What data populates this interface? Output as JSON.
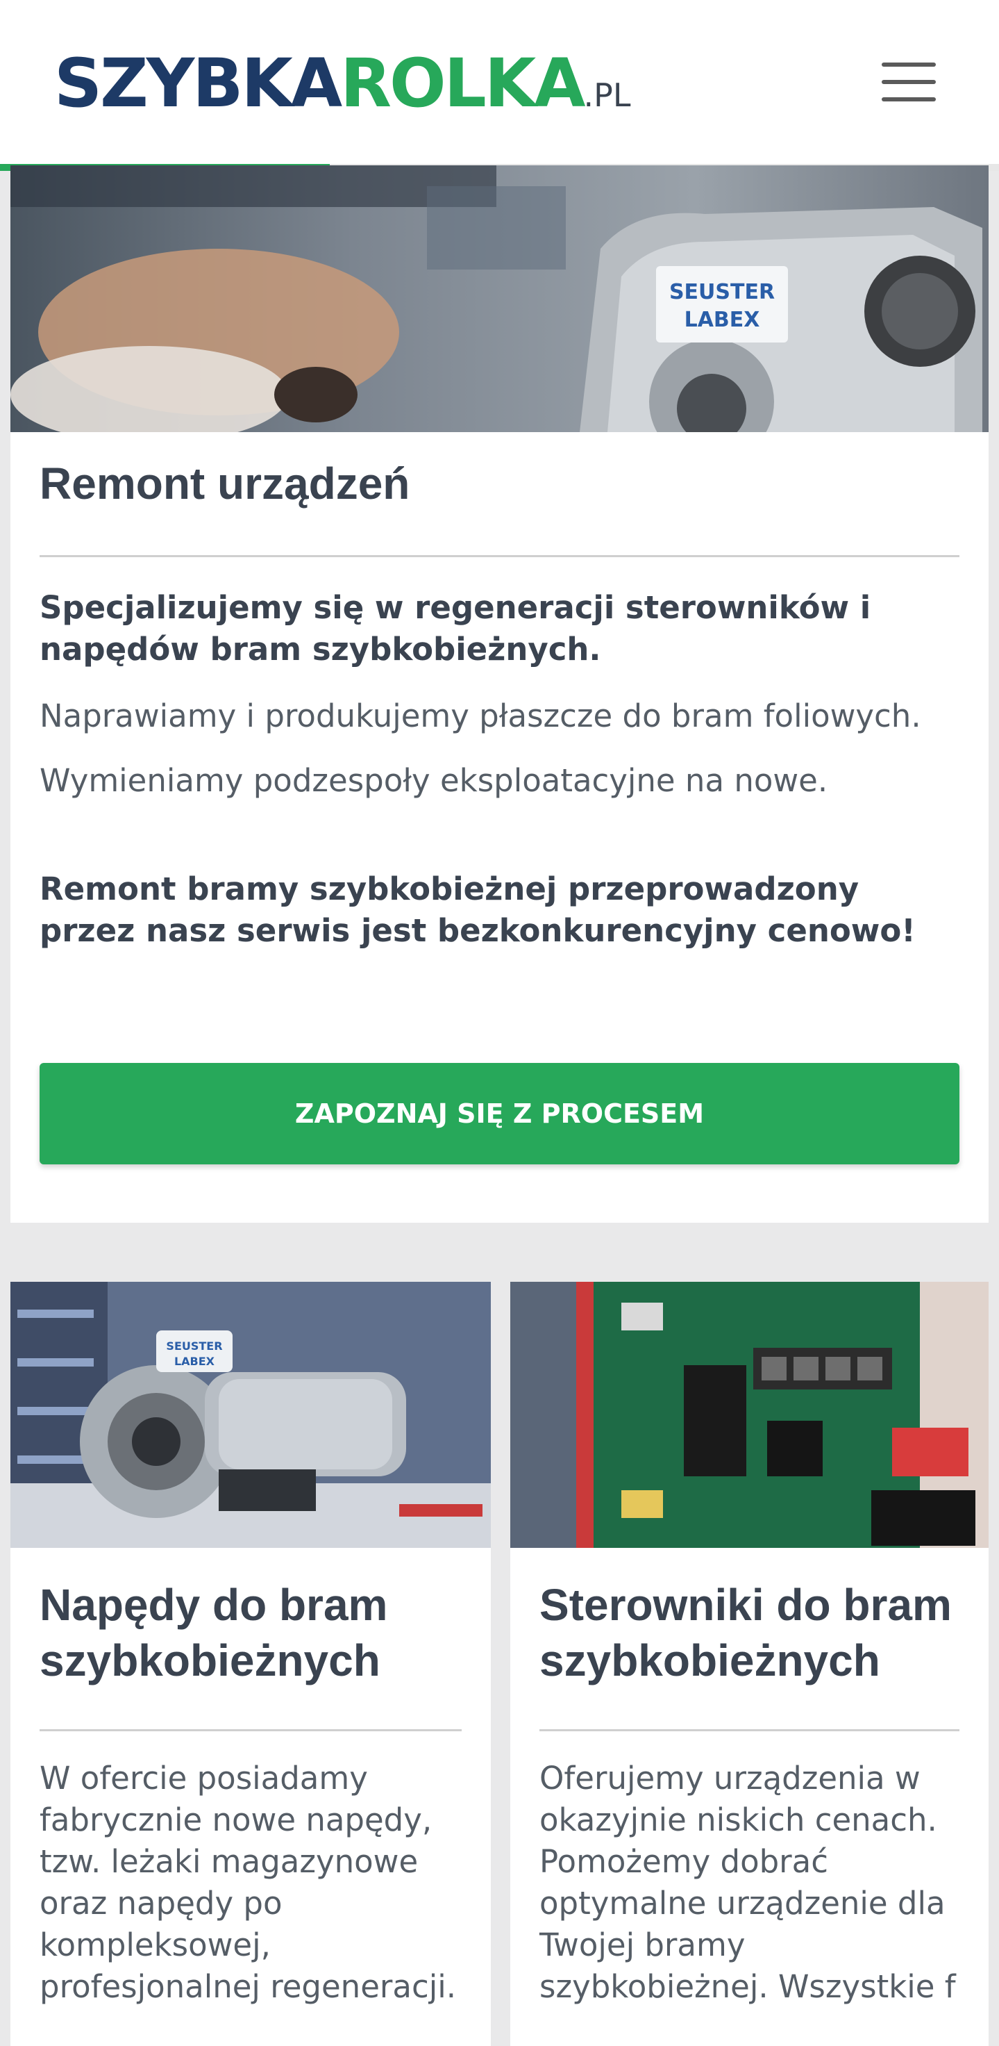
{
  "header": {
    "logo_part1": "SZYBKA",
    "logo_part2": "ROLKA",
    "logo_part3": ".PL",
    "menu_icon": "hamburger-menu-icon",
    "reading_progress": 0.33
  },
  "colors": {
    "brand_navy": "#1d3a66",
    "brand_green": "#27a85a",
    "text": "#3a4350",
    "background": "#e9e9ea"
  },
  "featured": {
    "image": "gear-motor-photo",
    "title": "Remont urządzeń",
    "intro_bold": "Specjalizujemy się w regeneracji sterowników i napędów bram szybkobieżnych.",
    "line1": "Naprawiamy i produkujemy płaszcze do bram foliowych.",
    "line2": "Wymieniamy podzespoły eksploatacyjne na nowe.",
    "closing_bold": "Remont bramy szybkobieżnej przeprowadzony przez nasz serwis jest bezkonkurencyjny cenowo!",
    "cta_label": "ZAPOZNAJ SIĘ Z PROCESEM"
  },
  "cards": [
    {
      "image": "drive-unit-photo",
      "title": "Napędy do bram szybkobieżnych",
      "text": "W ofercie posiadamy fabrycznie nowe napędy, tzw. leżaki magazynowe oraz napędy po kompleksowej, profesjonalnej regeneracji."
    },
    {
      "image": "controller-board-photo",
      "title": "Sterowniki do bram szybkobieżnych",
      "text": "Oferujemy urządzenia w okazyjnie niskich cenach. Pomożemy dobrać optymalne urządzenie dla Twojej bramy szybkobieżnej. Wszystkie f"
    }
  ]
}
